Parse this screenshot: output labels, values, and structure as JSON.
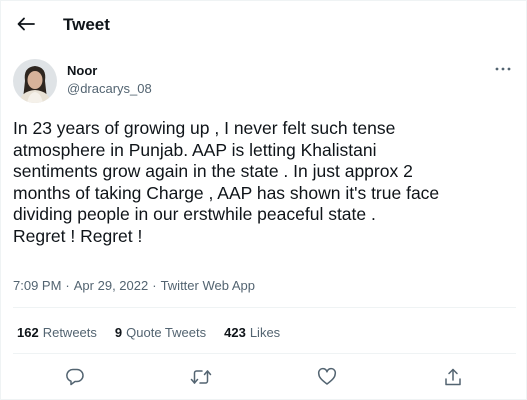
{
  "header": {
    "title": "Tweet"
  },
  "author": {
    "name": "Noor",
    "handle": "@dracarys_08"
  },
  "tweet": {
    "text": "In 23 years of growing up , I never felt such tense\natmosphere in Punjab. AAP is letting Khalistani\nsentiments grow again in the state . In just approx 2\nmonths of taking Charge , AAP has shown it's true face\ndividing people in our erstwhile peaceful state .\nRegret ! Regret !",
    "time": "7:09 PM",
    "separator1": "·",
    "date": "Apr 29, 2022",
    "separator2": "·",
    "source": "Twitter Web App"
  },
  "stats": {
    "retweets_count": "162",
    "retweets_label": "Retweets",
    "quotes_count": "9",
    "quotes_label": "Quote Tweets",
    "likes_count": "423",
    "likes_label": "Likes"
  },
  "icons": {
    "back": "arrow-left-icon",
    "more": "more-horizontal-icon",
    "reply": "reply-icon",
    "retweet": "retweet-icon",
    "like": "heart-icon",
    "share": "share-icon"
  },
  "colors": {
    "text_primary": "#0f1419",
    "text_secondary": "#536471",
    "divider": "#eff3f4"
  }
}
